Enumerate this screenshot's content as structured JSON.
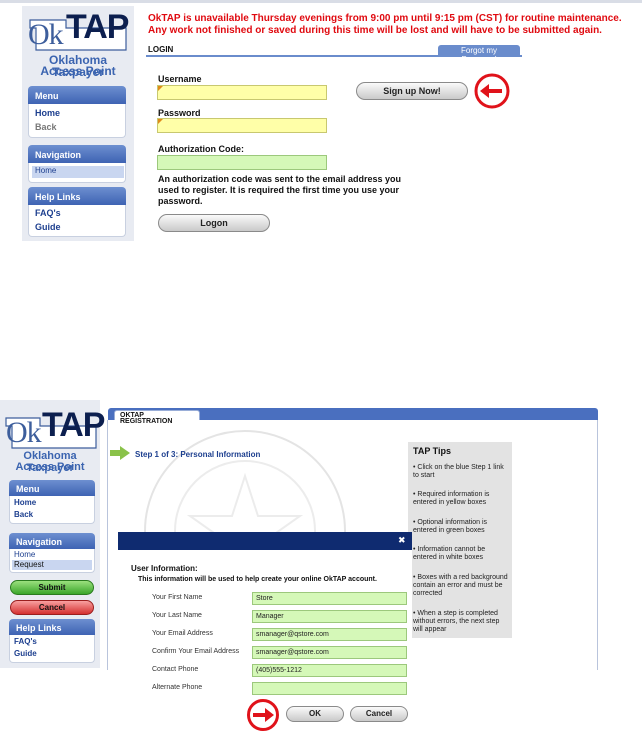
{
  "login": {
    "logo_ok": "Ok",
    "logo_tap": "TAP",
    "logo_sub1": "Oklahoma Taxpayer",
    "logo_sub2": "Access Point",
    "menu_title": "Menu",
    "menu_home": "Home",
    "menu_back": "Back",
    "nav_title": "Navigation",
    "nav_home": "Home",
    "help_title": "Help Links",
    "help_faq": "FAQ's",
    "help_guide": "Guide",
    "maint_line1": "OkTAP is unavailable Thursday evenings from 9:00 pm until 9:15 pm (CST) for routine maintenance.",
    "maint_line2": "Any work not finished or saved during this time will be lost and will have to be submitted again.",
    "bar_label": "LOGIN",
    "forgot": "Forgot my Password",
    "username_label": "Username",
    "username_value": "",
    "password_label": "Password",
    "password_value": "",
    "auth_label": "Authorization Code:",
    "auth_value": "",
    "auth_note1": "An authorization code was sent to the email address you",
    "auth_note2": "used to register. It is required the first time you use your",
    "auth_note3": "password.",
    "signup": "Sign up Now!",
    "logon": "Logon"
  },
  "registration": {
    "logo_ok": "Ok",
    "logo_tap": "TAP",
    "logo_sub1": "Oklahoma Taxpayer",
    "logo_sub2": "Access Point",
    "tab_label": "OKTAP REGISTRATION",
    "step_label": "Step 1 of 3: Personal Information",
    "menu_title": "Menu",
    "menu_home": "Home",
    "menu_back": "Back",
    "nav_title": "Navigation",
    "nav_home": "Home",
    "nav_request": "Request",
    "submit": "Submit",
    "cancel": "Cancel",
    "help_title": "Help Links",
    "help_faq": "FAQ's",
    "help_guide": "Guide",
    "tips_title": "TAP Tips",
    "tips": [
      "• Click on the blue Step 1 link to start",
      "• Required information is entered in yellow boxes",
      "• Optional information is entered in green boxes",
      "• Information cannot be entered in white boxes",
      "• Boxes with a red background contain an error and must be corrected",
      "• When a step is completed without errors, the next step will appear"
    ],
    "modal": {
      "close": "✖",
      "title": "User Information:",
      "subtitle": "This information will be used to help create your online OkTAP account.",
      "fields": [
        {
          "label": "Your First Name",
          "value": "Store"
        },
        {
          "label": "Your Last Name",
          "value": "Manager"
        },
        {
          "label": "Your Email Address",
          "value": "smanager@qstore.com"
        },
        {
          "label": "Confirm Your Email Address",
          "value": "smanager@qstore.com"
        },
        {
          "label": "Contact Phone",
          "value": "(405)555-1212"
        },
        {
          "label": "Alternate Phone",
          "value": ""
        }
      ],
      "ok": "OK",
      "cancel": "Cancel"
    }
  },
  "colors": {
    "annotation_red": "#e0121a",
    "brand_blue": "#3e63b3",
    "required_yellow": "#ffffa8",
    "optional_green": "#d5f8b8"
  },
  "icons": [
    "back-arrow-annotation-icon",
    "right-arrow-icon",
    "close-icon",
    "oklahoma-map-logo-icon"
  ]
}
